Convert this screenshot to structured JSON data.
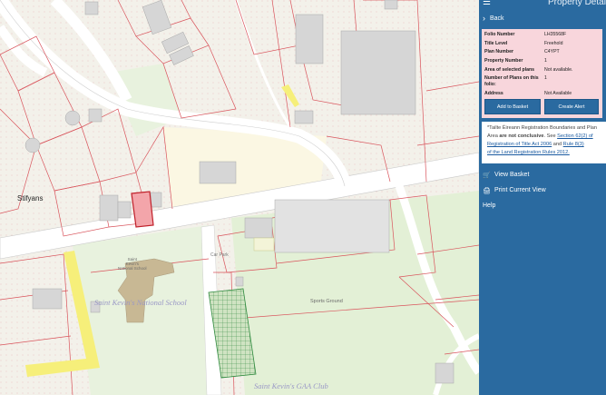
{
  "map": {
    "labels": {
      "town": "Stifyans",
      "school": "Saint Kevin's National School",
      "school_small_1": "Saint",
      "school_small_2": "Kevin's",
      "school_small_3": "National School",
      "car_park": "Car Park",
      "sports_ground": "Sports Ground",
      "gaa_club": "Saint Kevin's GAA Club"
    },
    "colors": {
      "background": "#f3f1ea",
      "parcel_line": "#d9545c",
      "road": "#ffffff",
      "highlight_parcel": "#f3a5aa",
      "yellow_parcel": "#f6ef7a",
      "green_field": "#e3f0d6",
      "building": "#d6d6d6",
      "school_building": "#c8b894"
    }
  },
  "panel": {
    "title": "Property Details",
    "back_label": "Back",
    "details": [
      {
        "label": "Folio Number",
        "value": "LH35568F"
      },
      {
        "label": "Title Level",
        "value": "Freehold"
      },
      {
        "label": "Plan Number",
        "value": "C4YPT"
      },
      {
        "label": "Property Number",
        "value": "1"
      },
      {
        "label": "Area of selected plans",
        "value": "Not available."
      },
      {
        "label": "Number of Plans on this folio:",
        "value": "1"
      },
      {
        "label": "Address",
        "value": "Not Available"
      }
    ],
    "buttons": {
      "add_to_basket": "Add to Basket",
      "create_alert": "Create Alert"
    },
    "notice": {
      "line1": "*Tailte Éireann Registration Boundaries and Plan",
      "line2_pre": "Area ",
      "line2_bold": "are not conclusive",
      "line2_mid": ". See ",
      "line2_link": "Section 62(2) of",
      "line3_link": "Registration of Title Act 2006",
      "line3_mid": " and ",
      "line3_link2": "Rule 8(3)",
      "line4_link": "of the Land Registration Rules 2012."
    },
    "menu": {
      "view_basket": "View Basket",
      "print_view": "Print Current View",
      "help": "Help"
    },
    "colors": {
      "panel_bg": "#2a6aa0",
      "info_bg": "#f8d6dc"
    }
  }
}
